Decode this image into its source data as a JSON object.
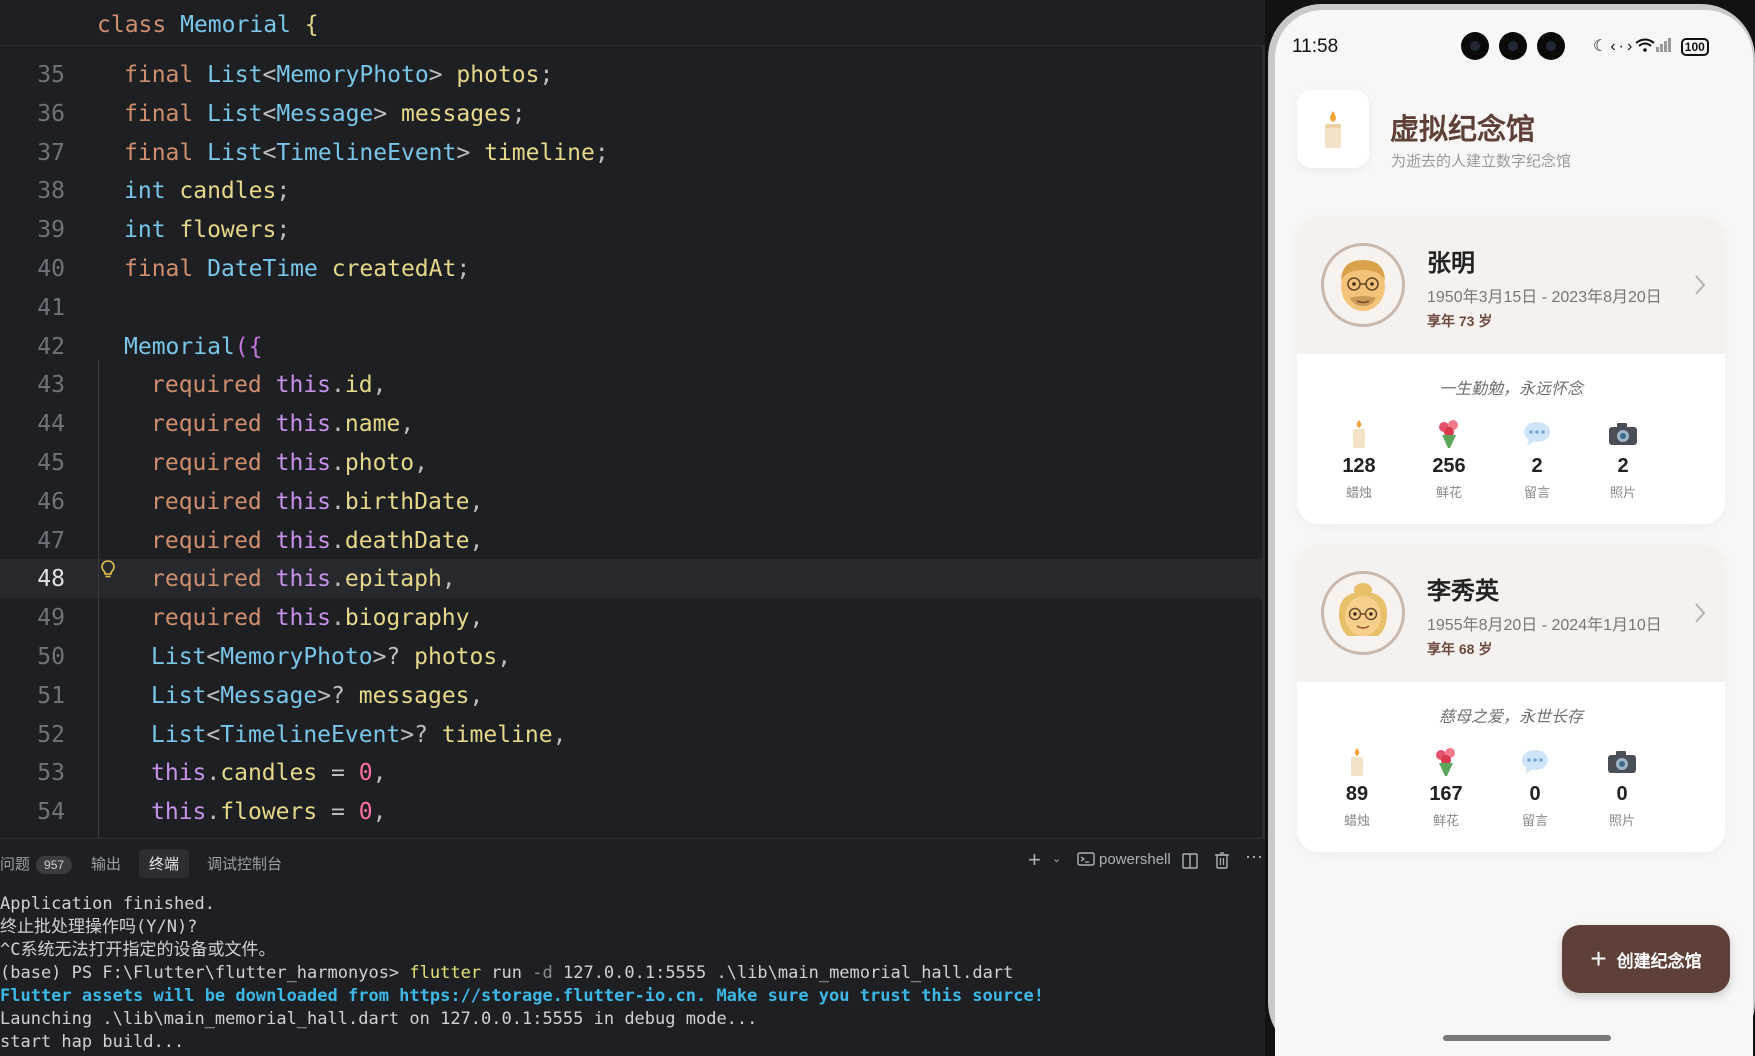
{
  "editor": {
    "sticky_header": {
      "kw": "class",
      "name": "Memorial",
      "brace": "{"
    },
    "lines": [
      {
        "n": "35",
        "parts": [
          [
            "kw",
            "final "
          ],
          [
            "ty",
            "List"
          ],
          [
            "pl",
            "<"
          ],
          [
            "ty",
            "MemoryPhoto"
          ],
          [
            "pl",
            "> "
          ],
          [
            "fn",
            "photos"
          ],
          [
            "pl",
            ";"
          ]
        ]
      },
      {
        "n": "36",
        "parts": [
          [
            "kw",
            "final "
          ],
          [
            "ty",
            "List"
          ],
          [
            "pl",
            "<"
          ],
          [
            "ty",
            "Message"
          ],
          [
            "pl",
            "> "
          ],
          [
            "fn",
            "messages"
          ],
          [
            "pl",
            ";"
          ]
        ]
      },
      {
        "n": "37",
        "parts": [
          [
            "kw",
            "final "
          ],
          [
            "ty",
            "List"
          ],
          [
            "pl",
            "<"
          ],
          [
            "ty",
            "TimelineEvent"
          ],
          [
            "pl",
            "> "
          ],
          [
            "fn",
            "timeline"
          ],
          [
            "pl",
            ";"
          ]
        ]
      },
      {
        "n": "38",
        "parts": [
          [
            "ty",
            "int "
          ],
          [
            "fn",
            "candles"
          ],
          [
            "pl",
            ";"
          ]
        ]
      },
      {
        "n": "39",
        "parts": [
          [
            "ty",
            "int "
          ],
          [
            "fn",
            "flowers"
          ],
          [
            "pl",
            ";"
          ]
        ]
      },
      {
        "n": "40",
        "parts": [
          [
            "kw",
            "final "
          ],
          [
            "ty",
            "DateTime "
          ],
          [
            "fn",
            "createdAt"
          ],
          [
            "pl",
            ";"
          ]
        ]
      },
      {
        "n": "41",
        "parts": []
      },
      {
        "n": "42",
        "parts": [
          [
            "ty",
            "Memorial"
          ],
          [
            "br",
            "({"
          ]
        ]
      },
      {
        "n": "43",
        "indent": 2,
        "parts": [
          [
            "kw",
            "required "
          ],
          [
            "th",
            "this"
          ],
          [
            "pl",
            "."
          ],
          [
            "fn",
            "id"
          ],
          [
            "pl",
            ","
          ]
        ]
      },
      {
        "n": "44",
        "indent": 2,
        "parts": [
          [
            "kw",
            "required "
          ],
          [
            "th",
            "this"
          ],
          [
            "pl",
            "."
          ],
          [
            "fn",
            "name"
          ],
          [
            "pl",
            ","
          ]
        ]
      },
      {
        "n": "45",
        "indent": 2,
        "parts": [
          [
            "kw",
            "required "
          ],
          [
            "th",
            "this"
          ],
          [
            "pl",
            "."
          ],
          [
            "fn",
            "photo"
          ],
          [
            "pl",
            ","
          ]
        ]
      },
      {
        "n": "46",
        "indent": 2,
        "parts": [
          [
            "kw",
            "required "
          ],
          [
            "th",
            "this"
          ],
          [
            "pl",
            "."
          ],
          [
            "fn",
            "birthDate"
          ],
          [
            "pl",
            ","
          ]
        ]
      },
      {
        "n": "47",
        "indent": 2,
        "parts": [
          [
            "kw",
            "required "
          ],
          [
            "th",
            "this"
          ],
          [
            "pl",
            "."
          ],
          [
            "fn",
            "deathDate"
          ],
          [
            "pl",
            ","
          ]
        ]
      },
      {
        "n": "48",
        "indent": 2,
        "active": true,
        "parts": [
          [
            "kw",
            "required "
          ],
          [
            "th",
            "this"
          ],
          [
            "pl",
            "."
          ],
          [
            "fn",
            "epitaph"
          ],
          [
            "pl",
            ","
          ]
        ]
      },
      {
        "n": "49",
        "indent": 2,
        "parts": [
          [
            "kw",
            "required "
          ],
          [
            "th",
            "this"
          ],
          [
            "pl",
            "."
          ],
          [
            "fn",
            "biography"
          ],
          [
            "pl",
            ","
          ]
        ]
      },
      {
        "n": "50",
        "indent": 2,
        "parts": [
          [
            "ty",
            "List"
          ],
          [
            "pl",
            "<"
          ],
          [
            "ty",
            "MemoryPhoto"
          ],
          [
            "pl",
            ">? "
          ],
          [
            "fn",
            "photos"
          ],
          [
            "pl",
            ","
          ]
        ]
      },
      {
        "n": "51",
        "indent": 2,
        "parts": [
          [
            "ty",
            "List"
          ],
          [
            "pl",
            "<"
          ],
          [
            "ty",
            "Message"
          ],
          [
            "pl",
            ">? "
          ],
          [
            "fn",
            "messages"
          ],
          [
            "pl",
            ","
          ]
        ]
      },
      {
        "n": "52",
        "indent": 2,
        "parts": [
          [
            "ty",
            "List"
          ],
          [
            "pl",
            "<"
          ],
          [
            "ty",
            "TimelineEvent"
          ],
          [
            "pl",
            ">? "
          ],
          [
            "fn",
            "timeline"
          ],
          [
            "pl",
            ","
          ]
        ]
      },
      {
        "n": "53",
        "indent": 2,
        "parts": [
          [
            "th",
            "this"
          ],
          [
            "pl",
            "."
          ],
          [
            "fn",
            "candles"
          ],
          [
            "pl",
            " = "
          ],
          [
            "nm",
            "0"
          ],
          [
            "pl",
            ","
          ]
        ]
      },
      {
        "n": "54",
        "indent": 2,
        "parts": [
          [
            "th",
            "this"
          ],
          [
            "pl",
            "."
          ],
          [
            "fn",
            "flowers"
          ],
          [
            "pl",
            " = "
          ],
          [
            "nm",
            "0"
          ],
          [
            "pl",
            ","
          ]
        ]
      }
    ]
  },
  "panel": {
    "tabs": [
      {
        "label": "问题",
        "badge": "957"
      },
      {
        "label": "输出"
      },
      {
        "label": "终端",
        "selected": true
      },
      {
        "label": "调试控制台"
      }
    ],
    "shell_label": "powershell",
    "terminal_lines": [
      {
        "text": "Application finished."
      },
      {
        "text": "终止批处理操作吗(Y/N)?"
      },
      {
        "text": "^C系统无法打开指定的设备或文件。"
      },
      {
        "prompt": "(base) PS F:\\Flutter\\flutter_harmonyos> ",
        "cmd": "flutter",
        "rest1": " run ",
        "flag": "-d",
        "rest2": " 127.0.0.1:5555 .\\lib\\main_memorial_hall.dart"
      },
      {
        "text": "Flutter assets will be downloaded from https://storage.flutter-io.cn. Make sure you trust this source!",
        "warn": true
      },
      {
        "text": "Launching .\\lib\\main_memorial_hall.dart on 127.0.0.1:5555 in debug mode..."
      },
      {
        "text": "start hap build..."
      }
    ]
  },
  "phone": {
    "time": "11:58",
    "battery": "100",
    "app": {
      "title": "虚拟纪念馆",
      "subtitle": "为逝去的人建立数字纪念馆",
      "logo_icon": "candle-icon"
    },
    "memorials": [
      {
        "name": "张明",
        "dates": "1950年3月15日 - 2023年8月20日",
        "age": "享年 73 岁",
        "epitaph": "一生勤勉，永远怀念",
        "avatar_icon": "old-man-icon",
        "stats": [
          {
            "icon": "candle-icon",
            "value": "128",
            "label": "蜡烛"
          },
          {
            "icon": "bouquet-icon",
            "value": "256",
            "label": "鲜花"
          },
          {
            "icon": "speech-bubble-icon",
            "value": "2",
            "label": "留言"
          },
          {
            "icon": "camera-icon",
            "value": "2",
            "label": "照片"
          }
        ]
      },
      {
        "name": "李秀英",
        "dates": "1955年8月20日 - 2024年1月10日",
        "age": "享年 68 岁",
        "epitaph": "慈母之爱，永世长存",
        "avatar_icon": "old-woman-icon",
        "stats": [
          {
            "icon": "candle-icon",
            "value": "89",
            "label": "蜡烛"
          },
          {
            "icon": "bouquet-icon",
            "value": "167",
            "label": "鲜花"
          },
          {
            "icon": "speech-bubble-icon",
            "value": "0",
            "label": "留言"
          },
          {
            "icon": "camera-icon",
            "value": "0",
            "label": "照片"
          }
        ]
      }
    ],
    "fab_label": "创建纪念馆",
    "colors": {
      "accent": "#5e4038",
      "card_header": "#f4f1ee",
      "background": "#f9f7f5"
    }
  }
}
